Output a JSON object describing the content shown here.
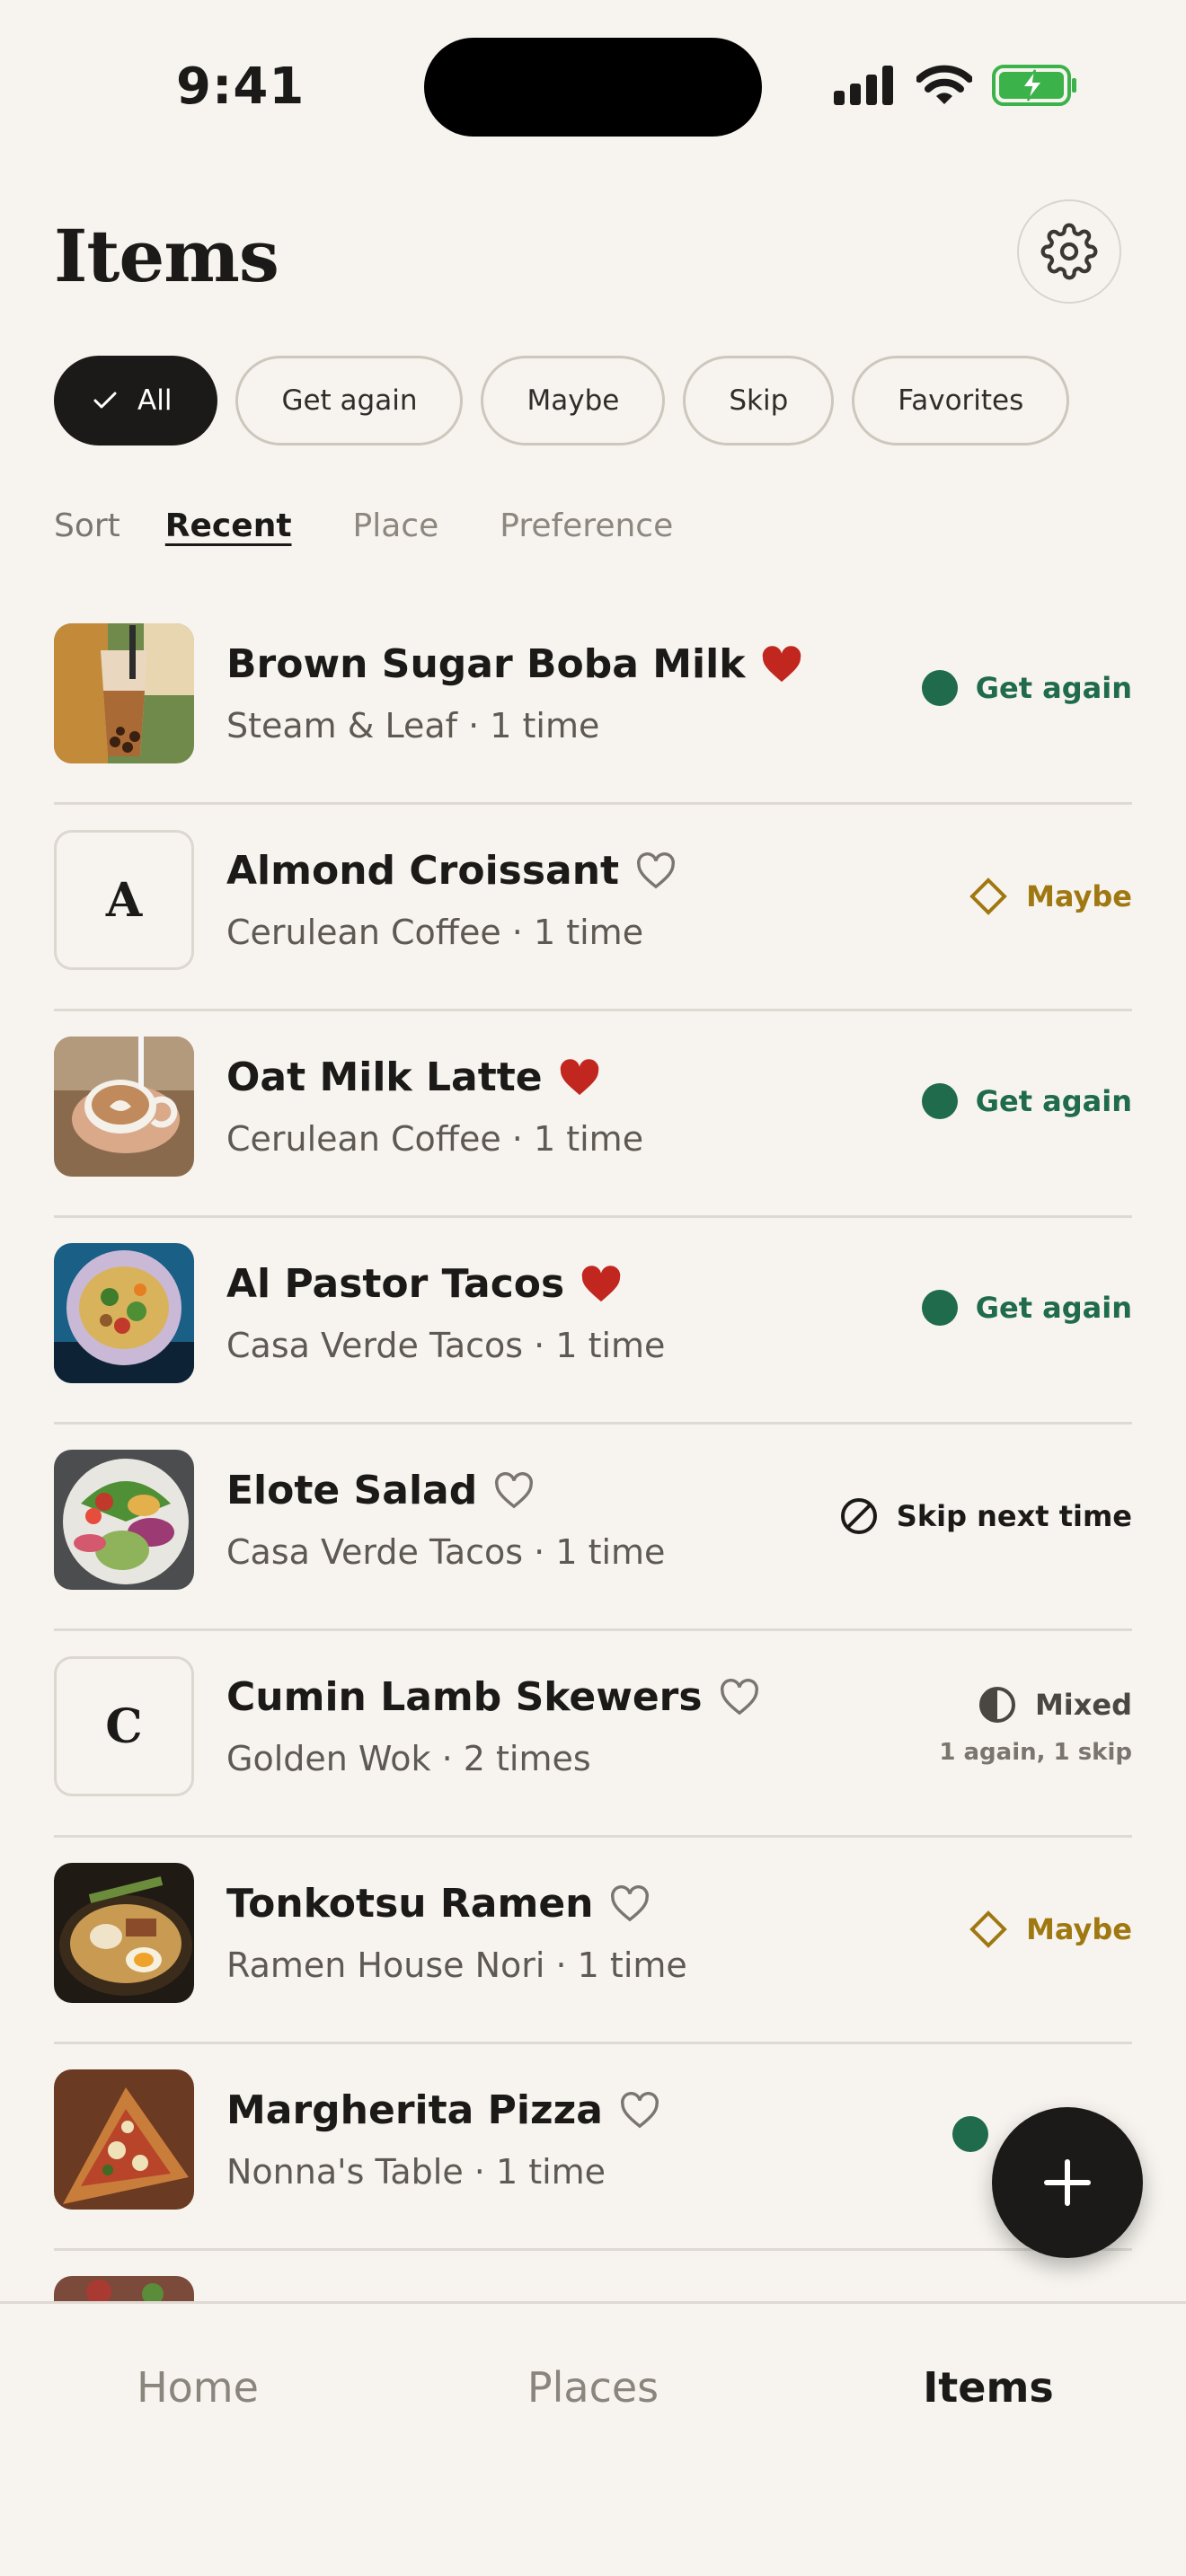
{
  "status_bar": {
    "time": "9:41"
  },
  "header": {
    "title": "Items"
  },
  "filters": [
    {
      "label": "All",
      "active": true
    },
    {
      "label": "Get again",
      "active": false
    },
    {
      "label": "Maybe",
      "active": false
    },
    {
      "label": "Skip",
      "active": false
    },
    {
      "label": "Favorites",
      "active": false
    }
  ],
  "sort": {
    "label": "Sort",
    "options": [
      {
        "label": "Recent",
        "active": true
      },
      {
        "label": "Place",
        "active": false
      },
      {
        "label": "Preference",
        "active": false
      }
    ]
  },
  "items": [
    {
      "name": "Brown Sugar Boba Milk",
      "sub": "Steam & Leaf · 1 time",
      "favorite": true,
      "status": "Get again",
      "status_type": "again",
      "thumb": "photo"
    },
    {
      "name": "Almond Croissant",
      "sub": "Cerulean Coffee · 1 time",
      "favorite": false,
      "status": "Maybe",
      "status_type": "maybe",
      "thumb": "letter",
      "letter": "A"
    },
    {
      "name": "Oat Milk Latte",
      "sub": "Cerulean Coffee · 1 time",
      "favorite": true,
      "status": "Get again",
      "status_type": "again",
      "thumb": "photo"
    },
    {
      "name": "Al Pastor Tacos",
      "sub": "Casa Verde Tacos · 1 time",
      "favorite": true,
      "status": "Get again",
      "status_type": "again",
      "thumb": "photo"
    },
    {
      "name": "Elote Salad",
      "sub": "Casa Verde Tacos · 1 time",
      "favorite": false,
      "status": "Skip next time",
      "status_type": "skip",
      "thumb": "photo"
    },
    {
      "name": "Cumin Lamb Skewers",
      "sub": "Golden Wok · 2 times",
      "favorite": false,
      "status": "Mixed",
      "status_sub": "1 again, 1 skip",
      "status_type": "mixed",
      "thumb": "letter",
      "letter": "C"
    },
    {
      "name": "Tonkotsu Ramen",
      "sub": "Ramen House Nori · 1 time",
      "favorite": false,
      "status": "Maybe",
      "status_type": "maybe",
      "thumb": "photo"
    },
    {
      "name": "Margherita Pizza",
      "sub": "Nonna's Table · 1 time",
      "favorite": false,
      "status": "",
      "status_type": "again",
      "thumb": "photo"
    }
  ],
  "bottom_nav": [
    {
      "label": "Home",
      "active": false
    },
    {
      "label": "Places",
      "active": false
    },
    {
      "label": "Items",
      "active": true
    }
  ],
  "colors": {
    "background": "#f7f4ef",
    "accent_dark": "#1b1a18",
    "get_again": "#1f6b4c",
    "maybe": "#a07812",
    "favorite": "#c1271f"
  }
}
